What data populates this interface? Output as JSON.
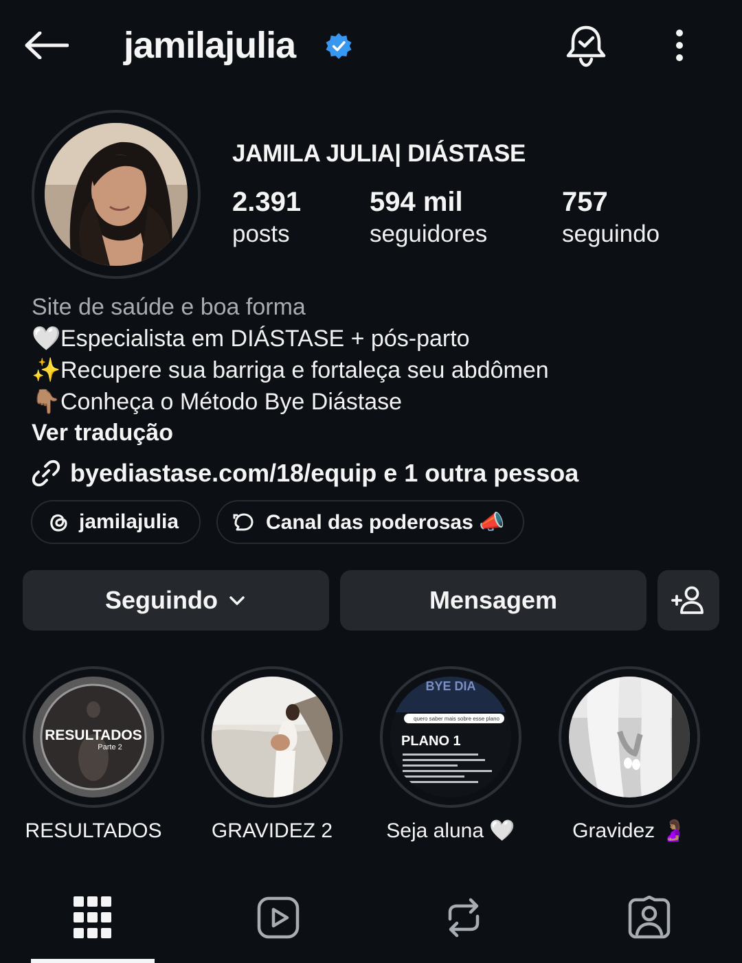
{
  "header": {
    "username": "jamilajulia",
    "back_icon": "arrow-left-icon",
    "verified_icon": "verified-badge-icon",
    "verified_color": "#3897f0",
    "bell_icon": "bell-check-icon",
    "more_icon": "more-vertical-icon"
  },
  "profile": {
    "full_name": "JAMILA JULIA| DIÁSTASE",
    "stats": [
      {
        "value": "2.391",
        "label": "posts"
      },
      {
        "value": "594 mil",
        "label": "seguidores"
      },
      {
        "value": "757",
        "label": "seguindo"
      }
    ]
  },
  "bio": {
    "category": "Site de saúde e boa forma",
    "lines": [
      {
        "emoji": "🤍",
        "text": "Especialista em DIÁSTASE + pós-parto"
      },
      {
        "emoji": "✨",
        "text": "Recupere sua barriga e fortaleça seu abdômen"
      },
      {
        "emoji": "👇🏽",
        "text": "Conheça o Método Bye Diástase"
      }
    ],
    "translate": "Ver tradução",
    "link": "byediastase.com/18/equip e 1 outra pessoa"
  },
  "pills": [
    {
      "icon": "threads-icon",
      "label": "jamilajulia"
    },
    {
      "icon": "broadcast-channel-icon",
      "label": "Canal das poderosas 📣"
    }
  ],
  "buttons": {
    "following": "Seguindo",
    "message": "Mensagem",
    "add_user_icon": "add-user-icon"
  },
  "highlights": [
    {
      "label": "RESULTADOS",
      "cover_text": "RESULTADOS",
      "cover_sub": "Parte 2"
    },
    {
      "label": "GRAVIDEZ 2"
    },
    {
      "label": "Seja aluna 🤍",
      "cover_text": "PLANO 1",
      "cover_top": "BYE DIA",
      "cover_search": "quero saber mais sobre esse plano"
    },
    {
      "label": "Gravidez 🤰🏽"
    }
  ],
  "tabs": [
    {
      "icon": "grid-icon",
      "active": true
    },
    {
      "icon": "reels-icon",
      "active": false
    },
    {
      "icon": "reposts-icon",
      "active": false
    },
    {
      "icon": "tagged-icon",
      "active": false
    }
  ]
}
